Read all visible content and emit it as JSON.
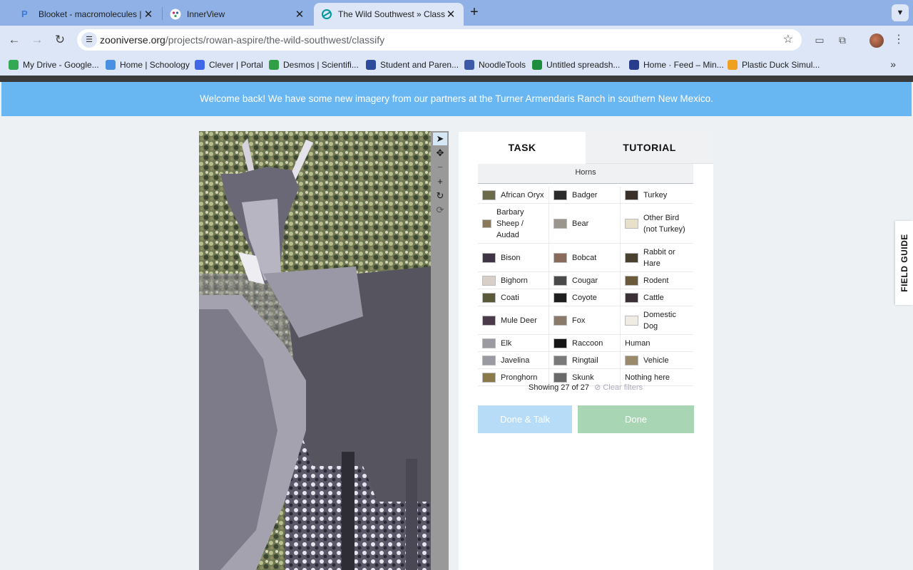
{
  "browser": {
    "tabs": [
      {
        "title": "Blooket - macromolecules | S",
        "icon": "blooket-icon"
      },
      {
        "title": "InnerView",
        "icon": "innerview-icon"
      },
      {
        "title": "The Wild Southwest » Classif",
        "icon": "zooniverse-icon"
      }
    ],
    "url_domain": "zooniverse.org",
    "url_path": "/projects/rowan-aspire/the-wild-southwest/classify",
    "bookmarks": [
      {
        "label": "My Drive - Google...",
        "color": "#34a853"
      },
      {
        "label": "Home | Schoology",
        "color": "#4a90e2"
      },
      {
        "label": "Clever | Portal",
        "color": "#4266e8"
      },
      {
        "label": "Desmos | Scientifi...",
        "color": "#2f9e44"
      },
      {
        "label": "Student and Paren...",
        "color": "#2b4a9c"
      },
      {
        "label": "NoodleTools",
        "color": "#3d5aa8"
      },
      {
        "label": "Untitled spreadsh...",
        "color": "#1e8e3e"
      },
      {
        "label": "Home · Feed – Min...",
        "color": "#2a3c8c"
      },
      {
        "label": "Plastic Duck Simul...",
        "color": "#f0a020"
      }
    ]
  },
  "banner": {
    "text": "Welcome back! We have some new imagery from our partners at the Turner Armendaris Ranch in southern New Mexico."
  },
  "panel": {
    "tab_task": "TASK",
    "tab_tutorial": "TUTORIAL",
    "filter_label": "Horns",
    "species": [
      [
        {
          "name": "African Oryx",
          "thumb": "#6b6a4a"
        },
        {
          "name": "Badger",
          "thumb": "#2b2b2b"
        },
        {
          "name": "Turkey",
          "thumb": "#3a3028"
        }
      ],
      [
        {
          "name": "Barbary Sheep / Audad",
          "thumb": "#8a7a5a"
        },
        {
          "name": "Bear",
          "thumb": "#9a968e"
        },
        {
          "name": "Other Bird (not Turkey)",
          "thumb": "#e8e0c8"
        }
      ],
      [
        {
          "name": "Bison",
          "thumb": "#3e3444"
        },
        {
          "name": "Bobcat",
          "thumb": "#8a6a5a"
        },
        {
          "name": "Rabbit or Hare",
          "thumb": "#4a4030"
        }
      ],
      [
        {
          "name": "Bighorn",
          "thumb": "#d8d0c8"
        },
        {
          "name": "Cougar",
          "thumb": "#4a4a4a"
        },
        {
          "name": "Rodent",
          "thumb": "#6a5a3a"
        }
      ],
      [
        {
          "name": "Coati",
          "thumb": "#5a5a3a"
        },
        {
          "name": "Coyote",
          "thumb": "#1e1e1e"
        },
        {
          "name": "Cattle",
          "thumb": "#3a3035"
        }
      ],
      [
        {
          "name": "Mule Deer",
          "thumb": "#4a3a4a"
        },
        {
          "name": "Fox",
          "thumb": "#8a7a6a"
        },
        {
          "name": "Domestic Dog",
          "thumb": "#f0ece4"
        }
      ],
      [
        {
          "name": "Elk",
          "thumb": "#9a9aa0"
        },
        {
          "name": "Raccoon",
          "thumb": "#151515"
        },
        {
          "name": "Human",
          "thumb": ""
        }
      ],
      [
        {
          "name": "Javelina",
          "thumb": "#9a9aa2"
        },
        {
          "name": "Ringtail",
          "thumb": "#7a7a7a"
        },
        {
          "name": "Vehicle",
          "thumb": "#9a8a6a"
        }
      ],
      [
        {
          "name": "Pronghorn",
          "thumb": "#8a7a4a"
        },
        {
          "name": "Skunk",
          "thumb": "#6a6a6a"
        },
        {
          "name": "Nothing here",
          "thumb": ""
        }
      ]
    ],
    "showing_text": "Showing 27 of 27",
    "clear_filters": "Clear filters",
    "btn_done_talk": "Done & Talk",
    "btn_done": "Done"
  },
  "field_guide": "FIELD GUIDE"
}
